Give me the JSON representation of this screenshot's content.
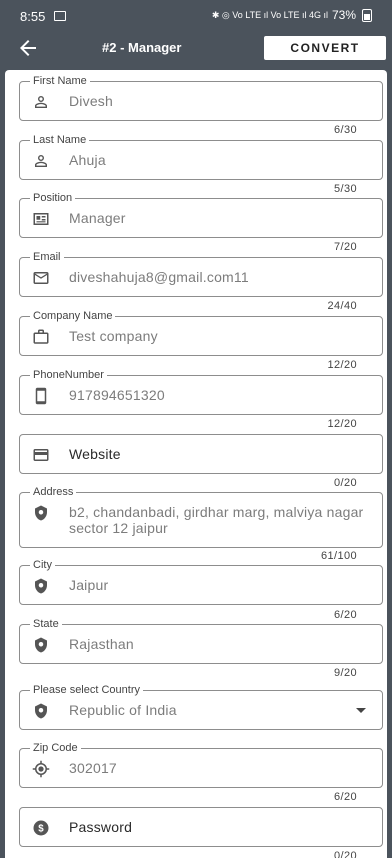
{
  "status_bar": {
    "time": "8:55",
    "icons": "✱ ◎ Vo LTE ıl Vo LTE ıl 4G ıl",
    "battery_text": "73%"
  },
  "app_bar": {
    "title": "#2 - Manager",
    "convert_label": "CONVERT"
  },
  "form": {
    "first_name": {
      "label": "First Name",
      "value": "Divesh",
      "counter": "6/30"
    },
    "last_name": {
      "label": "Last Name",
      "value": "Ahuja",
      "counter": "5/30"
    },
    "position": {
      "label": "Position",
      "value": "Manager",
      "counter": "7/20"
    },
    "email": {
      "label": "Email",
      "value": "diveshahuja8@gmail.com11",
      "counter": "24/40"
    },
    "company": {
      "label": "Company Name",
      "value": "Test company",
      "counter": "12/20"
    },
    "phone": {
      "label": "PhoneNumber",
      "value": "917894651320",
      "counter": "12/20"
    },
    "website": {
      "placeholder": "Website",
      "counter": "0/20"
    },
    "address": {
      "label": "Address",
      "value": "b2, chandanbadi, girdhar marg, malviya nagar sector 12 jaipur",
      "counter": "61/100"
    },
    "city": {
      "label": "City",
      "value": "Jaipur",
      "counter": "6/20"
    },
    "state": {
      "label": "State",
      "value": "Rajasthan",
      "counter": "9/20"
    },
    "country": {
      "label": "Please select Country",
      "value": "Republic of India"
    },
    "zip": {
      "label": "Zip Code",
      "value": "302017",
      "counter": "6/20"
    },
    "password": {
      "placeholder": "Password",
      "counter": "0/20"
    }
  },
  "colors": {
    "header_bg": "#4b535c",
    "card_bg": "#ffffff",
    "outline": "#8d8d8d"
  }
}
